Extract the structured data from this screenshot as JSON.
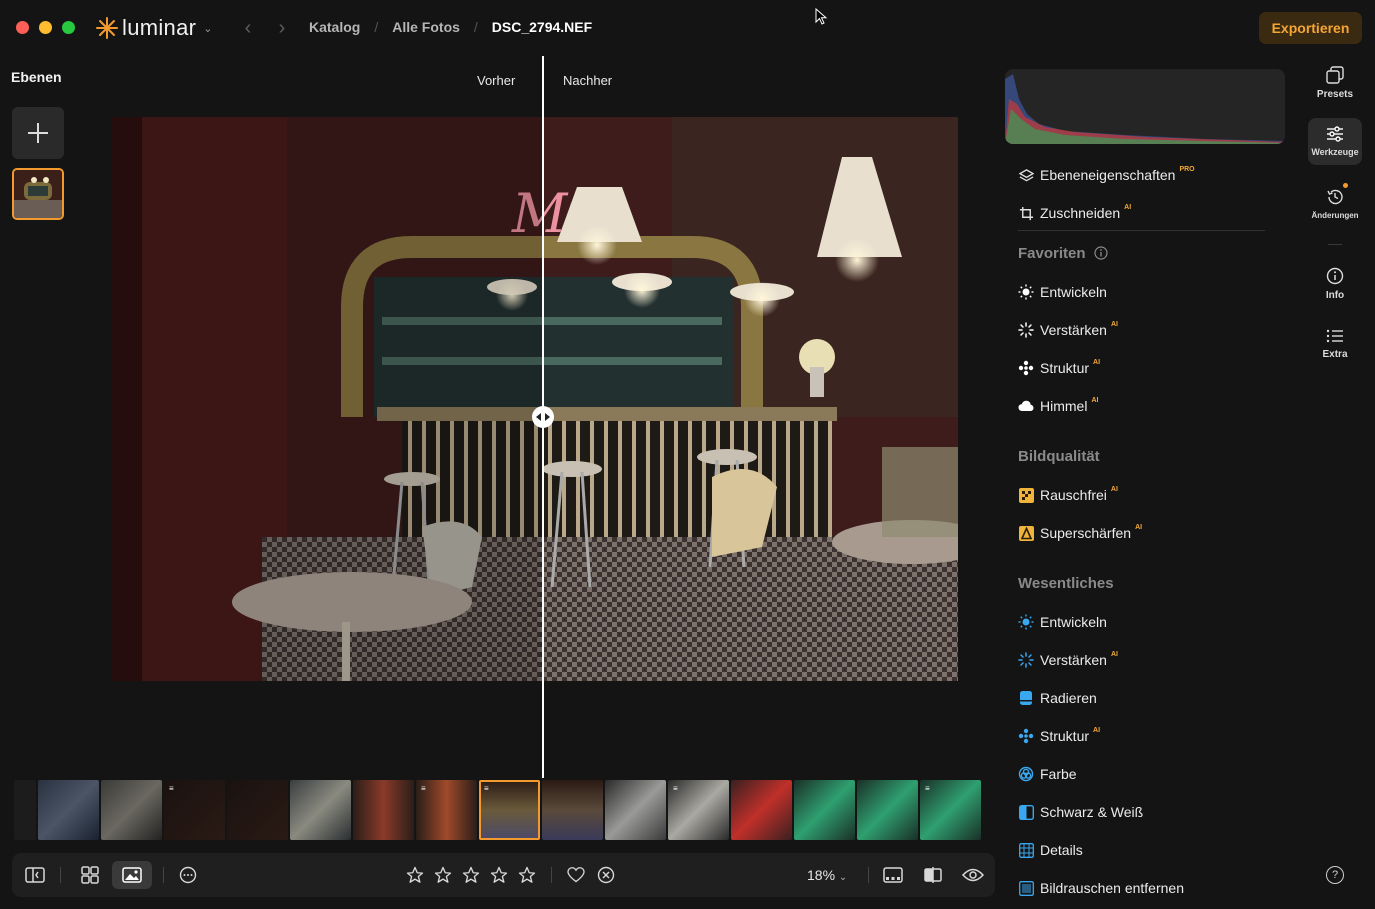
{
  "app": {
    "name": "luminar"
  },
  "breadcrumb": [
    "Katalog",
    "Alle Fotos",
    "DSC_2794.NEF"
  ],
  "header": {
    "export_label": "Exportieren"
  },
  "layers": {
    "title": "Ebenen"
  },
  "compare": {
    "before": "Vorher",
    "after": "Nachher"
  },
  "toolbar": {
    "zoom": "18%"
  },
  "tools": {
    "top": [
      {
        "label": "Ebeneneigenschaften",
        "badge": "PRO"
      },
      {
        "label": "Zuschneiden",
        "badge": "AI"
      }
    ],
    "sections": [
      {
        "title": "Favoriten",
        "items": [
          {
            "label": "Entwickeln",
            "badge": ""
          },
          {
            "label": "Verstärken",
            "badge": "AI"
          },
          {
            "label": "Struktur",
            "badge": "AI"
          },
          {
            "label": "Himmel",
            "badge": "AI"
          }
        ]
      },
      {
        "title": "Bildqualität",
        "items": [
          {
            "label": "Rauschfrei",
            "badge": "AI"
          },
          {
            "label": "Superschärfen",
            "badge": "AI"
          }
        ]
      },
      {
        "title": "Wesentliches",
        "items": [
          {
            "label": "Entwickeln",
            "badge": ""
          },
          {
            "label": "Verstärken",
            "badge": "AI"
          },
          {
            "label": "Radieren",
            "badge": ""
          },
          {
            "label": "Struktur",
            "badge": "AI"
          },
          {
            "label": "Farbe",
            "badge": ""
          },
          {
            "label": "Schwarz & Weiß",
            "badge": ""
          },
          {
            "label": "Details",
            "badge": ""
          },
          {
            "label": "Bildrauschen entfernen",
            "badge": ""
          }
        ]
      }
    ]
  },
  "rail": [
    {
      "label": "Presets"
    },
    {
      "label": "Werkzeuge"
    },
    {
      "label": "Änderungen"
    },
    {
      "label": "Info"
    },
    {
      "label": "Extra"
    }
  ],
  "colors": {
    "accent": "#f29a2e",
    "export_text": "#f6a532",
    "export_bg": "#3a2a12"
  }
}
